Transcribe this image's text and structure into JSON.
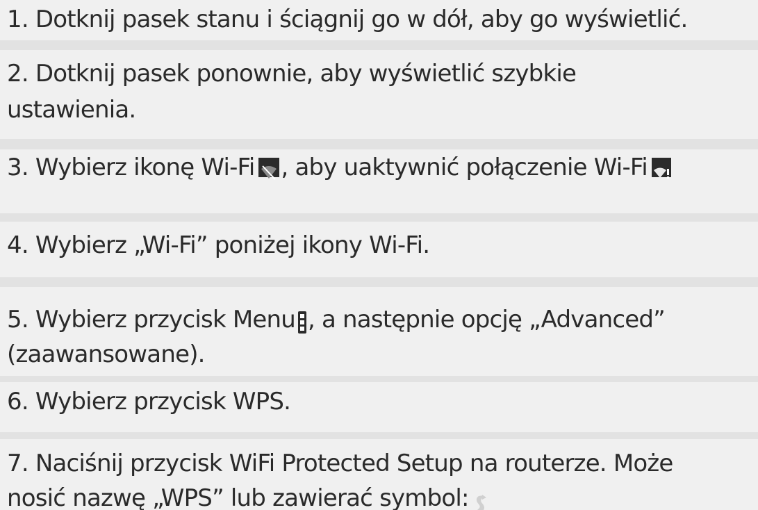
{
  "steps": [
    {
      "lines": [
        "1. Dotknij pasek stanu i ściągnij go w dół, aby go wyświetlić."
      ]
    },
    {
      "lines": [
        "2. Dotknij pasek ponownie, aby wyświetlić szybkie",
        "ustawienia."
      ]
    },
    {
      "before_icon1": "3. Wybierz ikonę Wi-Fi",
      "between": ", aby uaktywnić połączenie Wi-Fi"
    },
    {
      "lines": [
        "4. Wybierz „Wi-Fi” poniżej ikony Wi-Fi."
      ]
    },
    {
      "before_icon": "5. Wybierz przycisk Menu",
      "after_icon": ", a następnie opcję „Advanced”",
      "line2": "(zaawansowane)."
    },
    {
      "lines": [
        "6. Wybierz przycisk WPS."
      ]
    },
    {
      "line1": "7. Naciśnij przycisk WiFi Protected Setup na routerze. Może",
      "line2": "nosić nazwę „WPS” lub zawierać symbol:"
    }
  ],
  "icons": {
    "wifi_off": "wifi-off-icon",
    "wifi_on": "wifi-on-icon",
    "menu": "menu-icon",
    "wps_symbol": "wps-symbol-icon"
  },
  "colors": {
    "background": "#e2e2e2",
    "row": "#f0f0f0",
    "text": "#2a2a2a",
    "icon_dark": "#2b2b2b",
    "wps_symbol": "#d0d0d0"
  }
}
